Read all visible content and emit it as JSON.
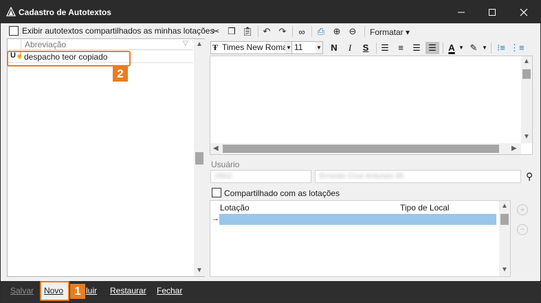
{
  "window": {
    "title": "Cadastro de Autotextos",
    "icons": [
      "app-icon",
      "minimize-icon",
      "maximize-icon",
      "close-icon"
    ]
  },
  "left": {
    "shared_checkbox_label": "Exibir autotextos compartilhados as minhas lotações",
    "list_header": "Abreviação",
    "items": [
      {
        "label": "despacho teor copiado"
      }
    ]
  },
  "toolbar": {
    "format_menu": "Formatar",
    "icons": [
      "cut-icon",
      "copy-icon",
      "paste-icon",
      "undo-icon",
      "redo-icon",
      "find-icon",
      "print-icon",
      "zoom-in-icon",
      "zoom-out-icon"
    ]
  },
  "format": {
    "font_family": "Times New Roman",
    "font_size": "11",
    "bold": "N",
    "italic": "I",
    "underline": "S",
    "font_color_letter": "A"
  },
  "user": {
    "label": "Usuário",
    "id_value": "0502",
    "name_value": "Ernesto Cruz Antunes 95"
  },
  "sharing": {
    "checkbox_label": "Compartilhado com as lotações",
    "columns": [
      "Lotação",
      "Tipo de Local"
    ],
    "add_symbol": "+",
    "remove_symbol": "−"
  },
  "bottom": {
    "save": "Salvar",
    "new": "Novo",
    "delete": "Excluir",
    "delete_visible": "luir",
    "restore": "Restaurar",
    "close": "Fechar"
  },
  "callouts": [
    "1",
    "2"
  ],
  "colors": {
    "titlebar": "#2b2b2b",
    "callout": "#e67e22",
    "selection": "#99c5ea"
  }
}
